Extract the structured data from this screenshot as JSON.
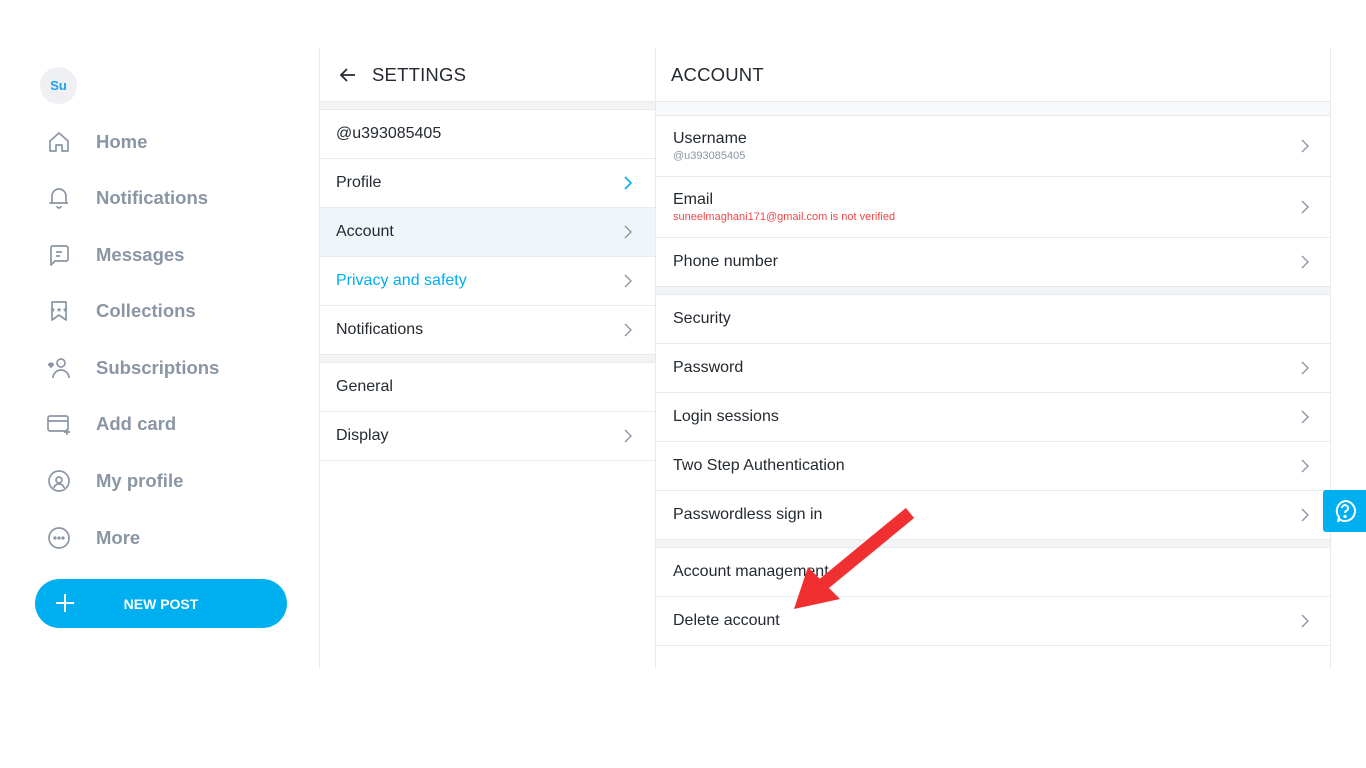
{
  "user": {
    "avatar_initials": "Su",
    "handle": "@u393085405",
    "email_status": "suneelmaghani171@gmail.com is not verified"
  },
  "nav": {
    "items": [
      {
        "label": "Home",
        "icon": "home-icon"
      },
      {
        "label": "Notifications",
        "icon": "bell-icon"
      },
      {
        "label": "Messages",
        "icon": "message-icon"
      },
      {
        "label": "Collections",
        "icon": "bookmark-icon"
      },
      {
        "label": "Subscriptions",
        "icon": "subscriptions-icon"
      },
      {
        "label": "Add card",
        "icon": "card-icon"
      },
      {
        "label": "My profile",
        "icon": "profile-icon"
      },
      {
        "label": "More",
        "icon": "more-icon"
      }
    ],
    "new_post_label": "NEW POST"
  },
  "settings": {
    "title": "SETTINGS",
    "handle": "@u393085405",
    "items": [
      {
        "label": "Profile"
      },
      {
        "label": "Account"
      },
      {
        "label": "Privacy and safety"
      },
      {
        "label": "Notifications"
      }
    ],
    "general_section": "General",
    "general_items": [
      {
        "label": "Display"
      }
    ]
  },
  "account": {
    "title": "ACCOUNT",
    "username_label": "Username",
    "username_value": "@u393085405",
    "email_label": "Email",
    "email_value": "suneelmaghani171@gmail.com is not verified",
    "phone_label": "Phone number",
    "security_section": "Security",
    "security_items": [
      {
        "label": "Password"
      },
      {
        "label": "Login sessions"
      },
      {
        "label": "Two Step Authentication"
      },
      {
        "label": "Passwordless sign in"
      }
    ],
    "management_section": "Account management",
    "delete_label": "Delete account"
  },
  "colors": {
    "brand": "#00aff0",
    "error": "#f24646",
    "muted": "#8a96a3",
    "annotation": "#f03030"
  }
}
